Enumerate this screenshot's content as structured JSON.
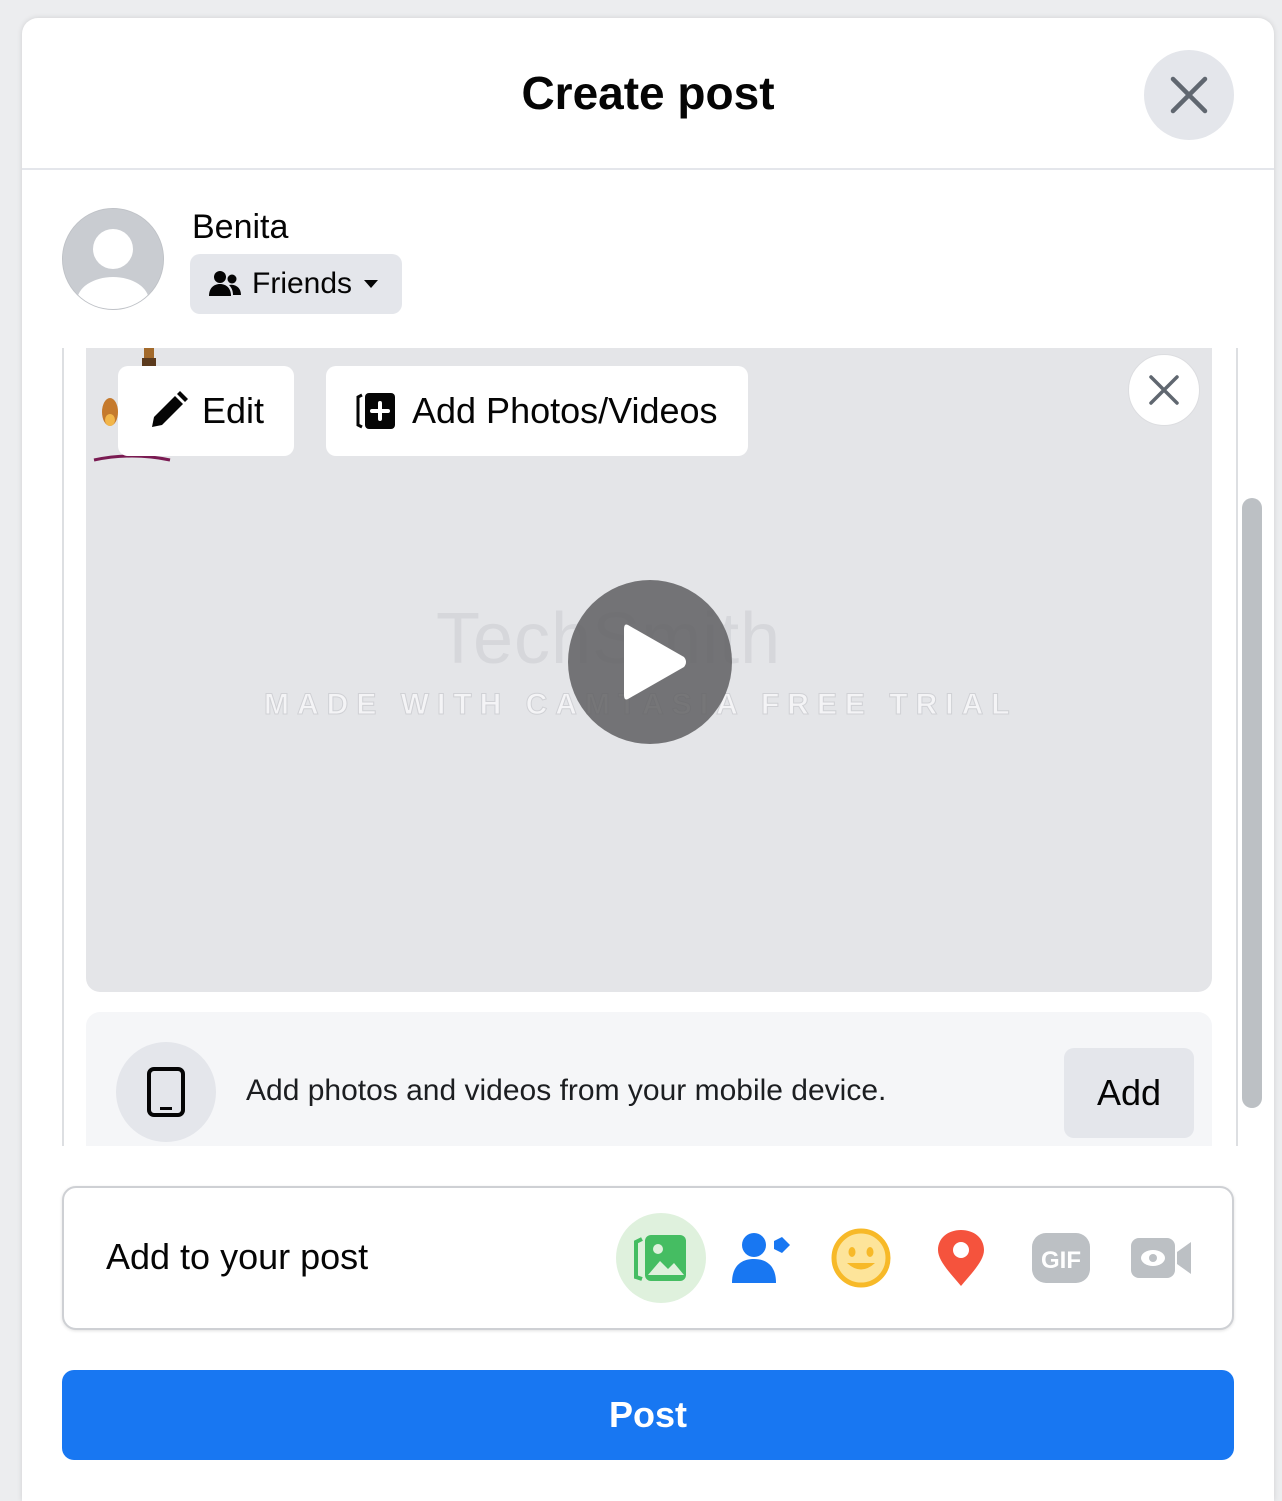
{
  "header": {
    "title": "Create post"
  },
  "user": {
    "name": "Benita",
    "audience": "Friends"
  },
  "media": {
    "edit_label": "Edit",
    "add_media_label": "Add Photos/Videos",
    "watermark_logo": "TechSmith",
    "watermark_text": "MADE WITH CAMTASIA FREE TRIAL"
  },
  "mobile": {
    "text": "Add photos and videos from your mobile device.",
    "add_label": "Add"
  },
  "add_to_post": {
    "label": "Add to your post",
    "icons": [
      "photo-video-icon",
      "tag-people-icon",
      "feeling-icon",
      "check-in-icon",
      "gif-icon",
      "live-video-icon"
    ]
  },
  "post_button": {
    "label": "Post"
  },
  "colors": {
    "primary": "#1877f2",
    "photo_green": "#45bd62",
    "tag_blue": "#1877f2",
    "feeling_yellow": "#f7b928",
    "checkin_red": "#f5533d",
    "disabled_gray": "#bcc0c4"
  }
}
